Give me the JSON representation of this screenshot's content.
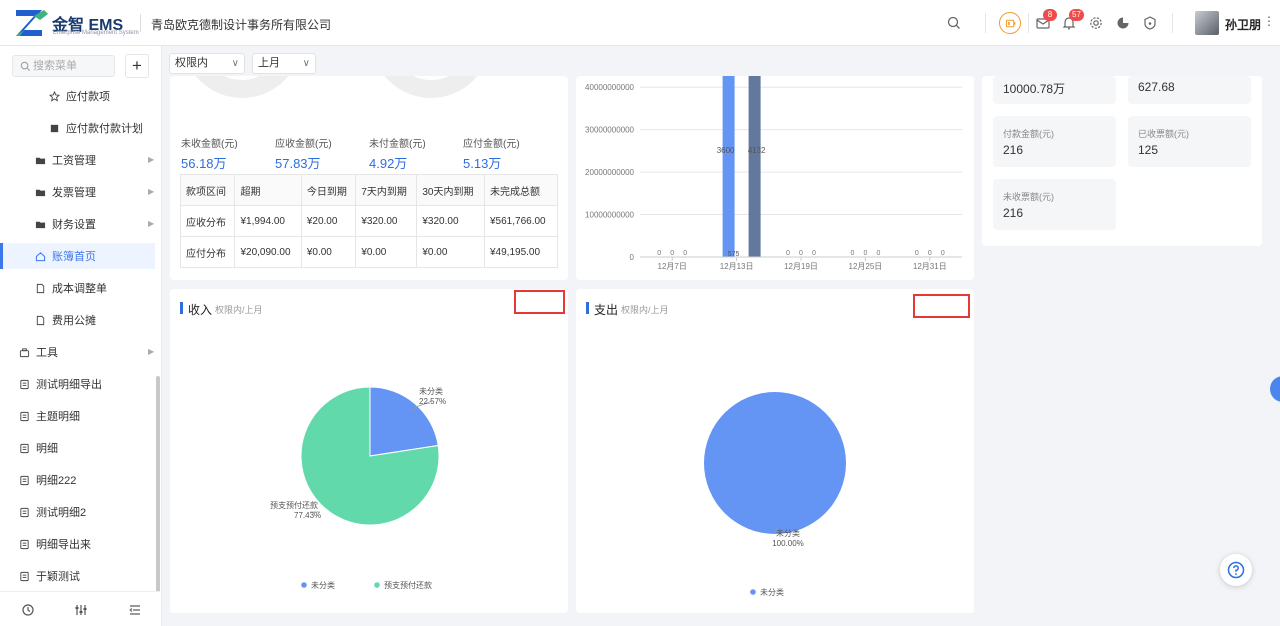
{
  "header": {
    "logo_text": "金智 EMS",
    "logo_sub": "Enterprise Management System",
    "company": "青岛欧克德制设计事务所有限公司",
    "icons": [
      "search-icon",
      "battery-icon",
      "mail-icon",
      "bell-icon",
      "gear-icon",
      "pie-icon",
      "shield-icon"
    ],
    "mail_badge": "8",
    "bell_badge": "57",
    "username": "孙卫朋",
    "brand_color": "#1f5fd0"
  },
  "sidebar": {
    "search_placeholder": "搜索菜单",
    "add_label": "+",
    "items": [
      {
        "label": "应付款项",
        "icon": "star-icon"
      },
      {
        "label": "应付款付款计划",
        "icon": "doc-icon"
      },
      {
        "label": "工资管理",
        "icon": "folder-icon"
      },
      {
        "label": "发票管理",
        "icon": "folder-icon"
      },
      {
        "label": "财务设置",
        "icon": "folder-icon"
      },
      {
        "label": "账簿首页",
        "icon": "home-icon"
      },
      {
        "label": "成本调整单",
        "icon": "file-icon"
      },
      {
        "label": "费用公摊",
        "icon": "file-icon"
      },
      {
        "label": "工具",
        "icon": "tool-icon"
      },
      {
        "label": "测试明细导出",
        "icon": "list-icon"
      },
      {
        "label": "主题明细",
        "icon": "list-icon"
      },
      {
        "label": "明细",
        "icon": "list-icon"
      },
      {
        "label": "明细222",
        "icon": "list-icon"
      },
      {
        "label": "测试明细2",
        "icon": "list-icon"
      },
      {
        "label": "明细导出来",
        "icon": "list-icon"
      },
      {
        "label": "于颖测试",
        "icon": "list-icon"
      }
    ],
    "footer_icons": [
      "history-icon",
      "sliders-icon",
      "menu-collapse-icon"
    ]
  },
  "filters": {
    "scope": "权限内",
    "period": "上月"
  },
  "summary": {
    "stats": [
      {
        "label": "未收金额(元)",
        "value": "56.18万"
      },
      {
        "label": "应收金额(元)",
        "value": "57.83万"
      },
      {
        "label": "未付金额(元)",
        "value": "4.92万"
      },
      {
        "label": "应付金额(元)",
        "value": "5.13万"
      }
    ],
    "table": {
      "headers": [
        "款项区间",
        "超期",
        "今日到期",
        "7天内到期",
        "30天内到期",
        "未完成总额"
      ],
      "rows": [
        [
          "应收分布",
          "¥1,994.00",
          "¥20.00",
          "¥320.00",
          "¥320.00",
          "¥561,766.00"
        ],
        [
          "应付分布",
          "¥20,090.00",
          "¥0.00",
          "¥0.00",
          "¥0.00",
          "¥49,195.00"
        ]
      ]
    }
  },
  "chart_data": [
    {
      "type": "bar",
      "categories": [
        "12月7日",
        "12月13日",
        "12月19日",
        "12月25日",
        "12月31日"
      ],
      "series": [
        {
          "values": [
            0,
            45000000000,
            0,
            0,
            0
          ]
        },
        {
          "values": [
            0,
            45000000000,
            0,
            0,
            0
          ]
        }
      ],
      "zero_labels": [
        "0",
        "0",
        "0"
      ],
      "annotations": [
        "3600",
        "4132",
        "575"
      ],
      "yticks": [
        "0",
        "10000000000",
        "20000000000",
        "30000000000",
        "40000000000"
      ],
      "ylim": [
        0,
        45000000000
      ],
      "colors": [
        "#6495f5",
        "#62789c"
      ]
    },
    {
      "type": "pie",
      "title": "收入",
      "subtitle": "权限内/上月",
      "slices": [
        {
          "label": "未分类",
          "value": 22.57,
          "pct_text": "22.57%",
          "color": "#6495f5"
        },
        {
          "label": "预支预付还款",
          "value": 77.43,
          "pct_text": "77.43%",
          "color": "#62d9aa"
        }
      ],
      "legend": [
        "未分类",
        "预支预付还款"
      ]
    },
    {
      "type": "pie",
      "title": "支出",
      "subtitle": "权限内/上月",
      "slices": [
        {
          "label": "未分类",
          "value": 100,
          "pct_text": "100.00%",
          "color": "#6495f5"
        }
      ],
      "legend": [
        "未分类"
      ]
    }
  ],
  "info_panel": {
    "items": [
      {
        "label": "",
        "value": "10000.78万"
      },
      {
        "label": "",
        "value": "627.68"
      },
      {
        "label": "付款金额(元)",
        "value": "216"
      },
      {
        "label": "已收票额(元)",
        "value": "125"
      },
      {
        "label": "未收票额(元)",
        "value": "216"
      }
    ]
  }
}
